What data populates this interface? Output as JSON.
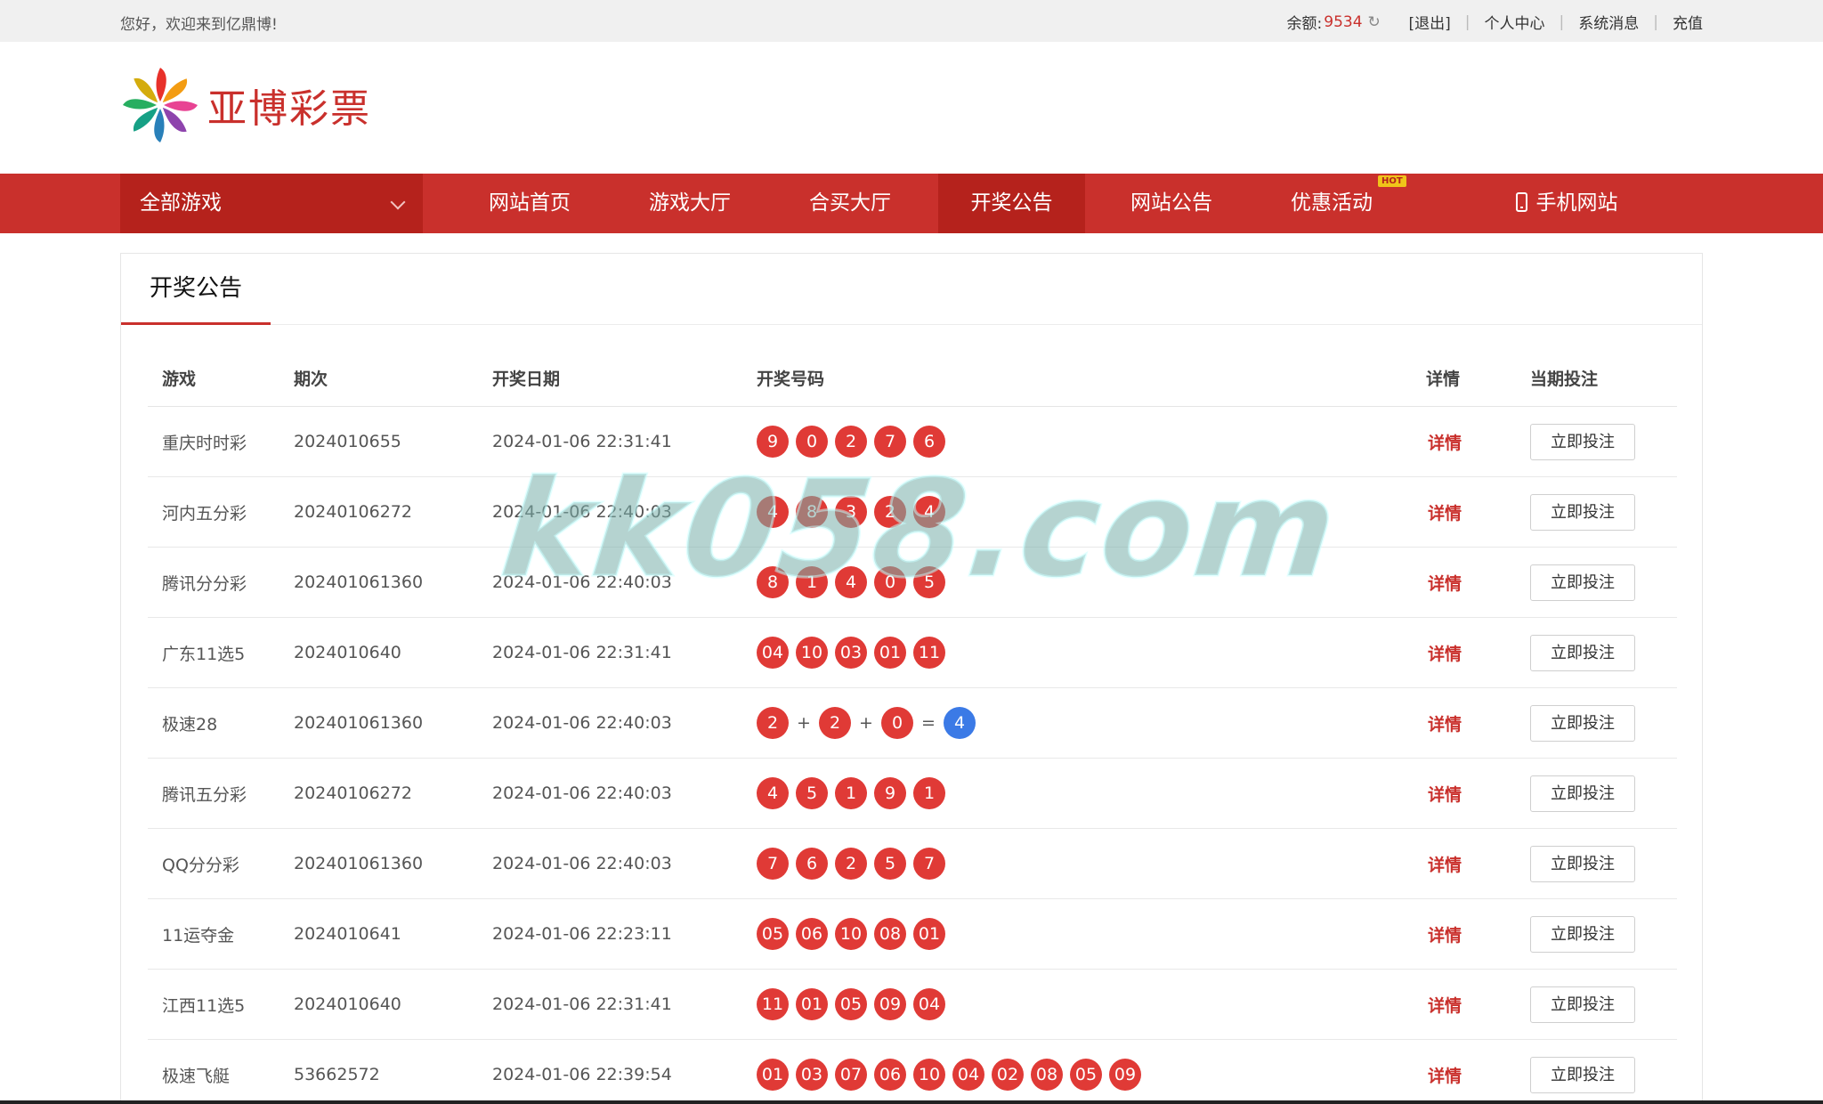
{
  "topbar": {
    "greeting": "您好，欢迎来到亿鼎博!",
    "balance_label": "余额:",
    "balance_value": "9534",
    "logout": "[退出]",
    "user_center": "个人中心",
    "messages": "系统消息",
    "recharge": "充值"
  },
  "logo": {
    "text": "亚博彩票"
  },
  "nav": {
    "all_games": "全部游戏",
    "items": [
      "网站首页",
      "游戏大厅",
      "合买大厅",
      "开奖公告",
      "网站公告",
      "优惠活动",
      "手机网站"
    ],
    "hot_badge": "HOT",
    "active_index": 3
  },
  "page": {
    "title": "开奖公告"
  },
  "table": {
    "headers": {
      "game": "游戏",
      "issue": "期次",
      "date": "开奖日期",
      "numbers": "开奖号码",
      "detail": "详情",
      "bet": "当期投注"
    },
    "detail_label": "详情",
    "bet_label": "立即投注",
    "rows": [
      {
        "game": "重庆时时彩",
        "issue": "2024010655",
        "date": "2024-01-06 22:31:41",
        "numbers": [
          "9",
          "0",
          "2",
          "7",
          "6"
        ]
      },
      {
        "game": "河内五分彩",
        "issue": "20240106272",
        "date": "2024-01-06 22:40:03",
        "numbers": [
          "4",
          "8",
          "3",
          "2",
          "4"
        ]
      },
      {
        "game": "腾讯分分彩",
        "issue": "202401061360",
        "date": "2024-01-06 22:40:03",
        "numbers": [
          "8",
          "1",
          "4",
          "0",
          "5"
        ]
      },
      {
        "game": "广东11选5",
        "issue": "2024010640",
        "date": "2024-01-06 22:31:41",
        "numbers": [
          "04",
          "10",
          "03",
          "01",
          "11"
        ]
      },
      {
        "game": "极速28",
        "issue": "202401061360",
        "date": "2024-01-06 22:40:03",
        "numbers": [
          "2",
          "2",
          "0"
        ],
        "ops": [
          "+",
          "+",
          "="
        ],
        "sum": "4"
      },
      {
        "game": "腾讯五分彩",
        "issue": "20240106272",
        "date": "2024-01-06 22:40:03",
        "numbers": [
          "4",
          "5",
          "1",
          "9",
          "1"
        ]
      },
      {
        "game": "QQ分分彩",
        "issue": "202401061360",
        "date": "2024-01-06 22:40:03",
        "numbers": [
          "7",
          "6",
          "2",
          "5",
          "7"
        ]
      },
      {
        "game": "11运夺金",
        "issue": "2024010641",
        "date": "2024-01-06 22:23:11",
        "numbers": [
          "05",
          "06",
          "10",
          "08",
          "01"
        ]
      },
      {
        "game": "江西11选5",
        "issue": "2024010640",
        "date": "2024-01-06 22:31:41",
        "numbers": [
          "11",
          "01",
          "05",
          "09",
          "04"
        ]
      },
      {
        "game": "极速飞艇",
        "issue": "53662572",
        "date": "2024-01-06 22:39:54",
        "numbers": [
          "01",
          "03",
          "07",
          "06",
          "10",
          "04",
          "02",
          "08",
          "05",
          "09"
        ]
      }
    ]
  },
  "watermark": "kk058.com",
  "colors": {
    "brand_red": "#c9302c",
    "nav_active": "#b5221c",
    "ball_red": "#e03a36",
    "ball_blue": "#3b7ae6"
  }
}
